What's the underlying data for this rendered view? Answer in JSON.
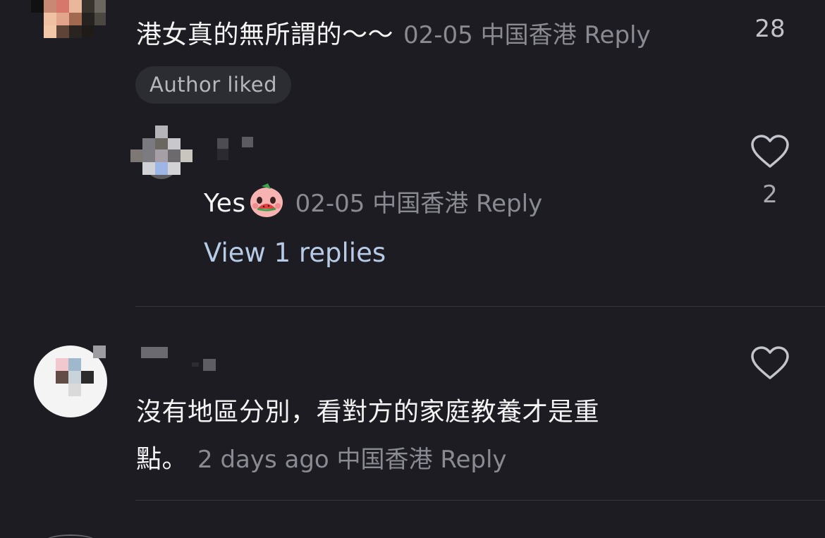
{
  "comments": [
    {
      "text": "港女真的無所謂的～～",
      "date": "02-05",
      "location": "中国香港",
      "reply_label": "Reply",
      "like_count": "28",
      "badge": "Author liked",
      "replies": [
        {
          "text": "Yes",
          "date": "02-05",
          "location": "中国香港",
          "reply_label": "Reply",
          "like_count": "2"
        }
      ],
      "view_replies_label": "View 1 replies"
    },
    {
      "text_line1": "沒有地區分別，看對方的家庭教養才是重",
      "text_line2": "點。",
      "date": "2 days ago",
      "location": "中国香港",
      "reply_label": "Reply"
    }
  ],
  "icons": {
    "like": "heart-outline-icon",
    "sticker": "watermelon-face-sticker"
  },
  "colors": {
    "background": "#1c1c22",
    "meta": "#8a8a93",
    "link": "#b7cbe6",
    "badge_bg": "#2c2c33"
  }
}
